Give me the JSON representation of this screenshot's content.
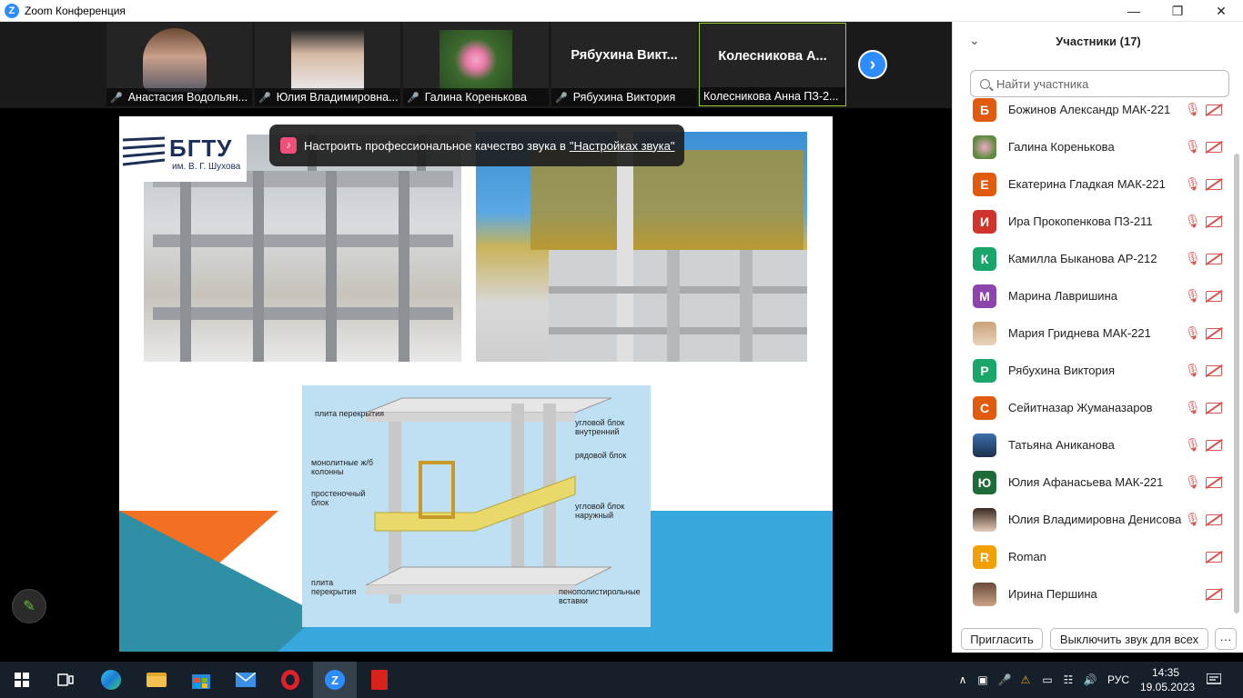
{
  "window": {
    "title": "Zoom Конференция",
    "app_icon_letter": "Z",
    "minimize": "—",
    "maximize": "❐",
    "close": "✕"
  },
  "thumbnails": [
    {
      "name": "Анастасия Водольян...",
      "type": "video",
      "muted": true
    },
    {
      "name": "Юлия Владимировна...",
      "type": "video",
      "muted": true
    },
    {
      "name": "Галина Коренькова",
      "type": "video",
      "muted": true
    },
    {
      "name": "Рябухина Виктория",
      "big_label": "Рябухина Викт...",
      "type": "name",
      "muted": true
    },
    {
      "name": "Колесникова Анна ПЗ-2...",
      "big_label": "Колесникова А...",
      "type": "name",
      "muted": false,
      "active": true
    }
  ],
  "slide": {
    "logo_title": "БГТУ",
    "logo_subtitle": "им. В. Г. Шухова",
    "diagram_labels": [
      "плита перекрытия",
      "угловой блок внутренний",
      "монолитные ж/б колонны",
      "рядовой блок",
      "простеночный блок",
      "угловой блок наружный",
      "плита перекрытия",
      "пенополистирольные вставки"
    ]
  },
  "tooltip": {
    "text": "Настроить профессиональное качество звука в",
    "link": "\"Настройках звука\""
  },
  "panel": {
    "title": "Участники (17)",
    "search_placeholder": "Найти участника",
    "participants": [
      {
        "name": "Божинов Александр МАК-221",
        "initial": "Б",
        "color": "#e05a10",
        "mic_muted": true
      },
      {
        "name": "Галина Коренькова",
        "initial": "",
        "color": "#9a7fa0",
        "photo": true,
        "mic_muted": true
      },
      {
        "name": "Екатерина Гладкая МАК-221",
        "initial": "Е",
        "color": "#e05a10",
        "mic_muted": true
      },
      {
        "name": "Ира Прокопенкова ПЗ-211",
        "initial": "И",
        "color": "#d0342c",
        "mic_muted": true
      },
      {
        "name": "Камилла Быканова АР-212",
        "initial": "К",
        "color": "#1aa56a",
        "mic_muted": true
      },
      {
        "name": "Марина Лавришина",
        "initial": "М",
        "color": "#8e44ad",
        "mic_muted": true
      },
      {
        "name": "Мария Гриднева МАК-221",
        "initial": "",
        "color": "#c9a27a",
        "photo": true,
        "mic_muted": true
      },
      {
        "name": "Рябухина Виктория",
        "initial": "Р",
        "color": "#1aa56a",
        "mic_muted": true
      },
      {
        "name": "Сейитназар Жуманазаров",
        "initial": "С",
        "color": "#e05a10",
        "mic_muted": true
      },
      {
        "name": "Татьяна Аниканова",
        "initial": "",
        "color": "#3a6fb0",
        "photo": true,
        "mic_muted": true
      },
      {
        "name": "Юлия Афанасьева МАК-221",
        "initial": "Ю",
        "color": "#1e6b3a",
        "mic_muted": true
      },
      {
        "name": "Юлия Владимировна Денисова",
        "initial": "",
        "color": "#5a3a2a",
        "photo": true,
        "mic_muted": true
      },
      {
        "name": "Roman",
        "initial": "R",
        "color": "#f2a007",
        "mic_muted": false
      },
      {
        "name": "Ирина Першина",
        "initial": "",
        "color": "#6b4a3a",
        "photo": true,
        "mic_muted": false
      }
    ],
    "invite_label": "Пригласить",
    "mute_all_label": "Выключить звук для всех",
    "more_label": "···"
  },
  "taskbar": {
    "language": "РУС",
    "time": "14:35",
    "date": "19.05.2023"
  }
}
